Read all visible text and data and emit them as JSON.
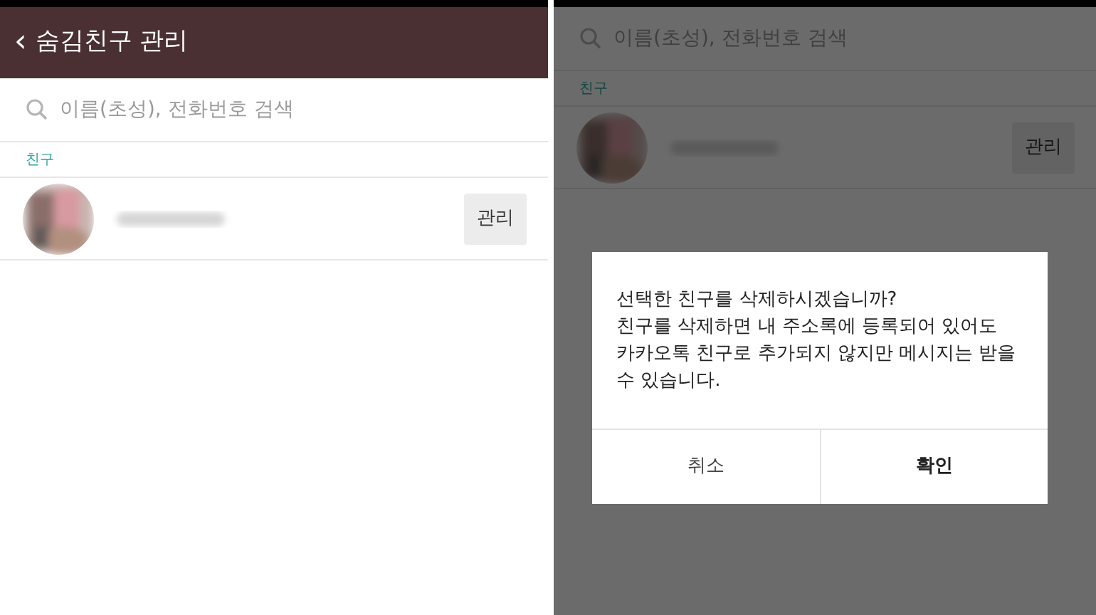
{
  "left_screen": {
    "header": {
      "back_icon": "‹",
      "title": "숨김친구 관리"
    },
    "search": {
      "placeholder": "이름(초성), 전화번호 검색"
    },
    "section": "친구",
    "friends": [
      {
        "kind": "picture",
        "button": "관리"
      }
    ]
  },
  "right_screen": {
    "search": {
      "placeholder": "이름(초성), 전화번호 검색"
    },
    "section": "친구",
    "friends": [
      {
        "kind": "picture",
        "button": "관리"
      }
    ],
    "dialog": {
      "message_lines": [
        "선택한 친구를 삭제하시겠습니까?",
        "친구를 삭제하면 내 주소록에 등록되어 있어도",
        "카카오톡 친구로 추가되지 않지만 메시지는 받을",
        "수 있습니다."
      ],
      "buttons": [
        {
          "label": "취소",
          "kind": "cancel"
        },
        {
          "label": "확인",
          "kind": "confirm"
        }
      ]
    }
  }
}
